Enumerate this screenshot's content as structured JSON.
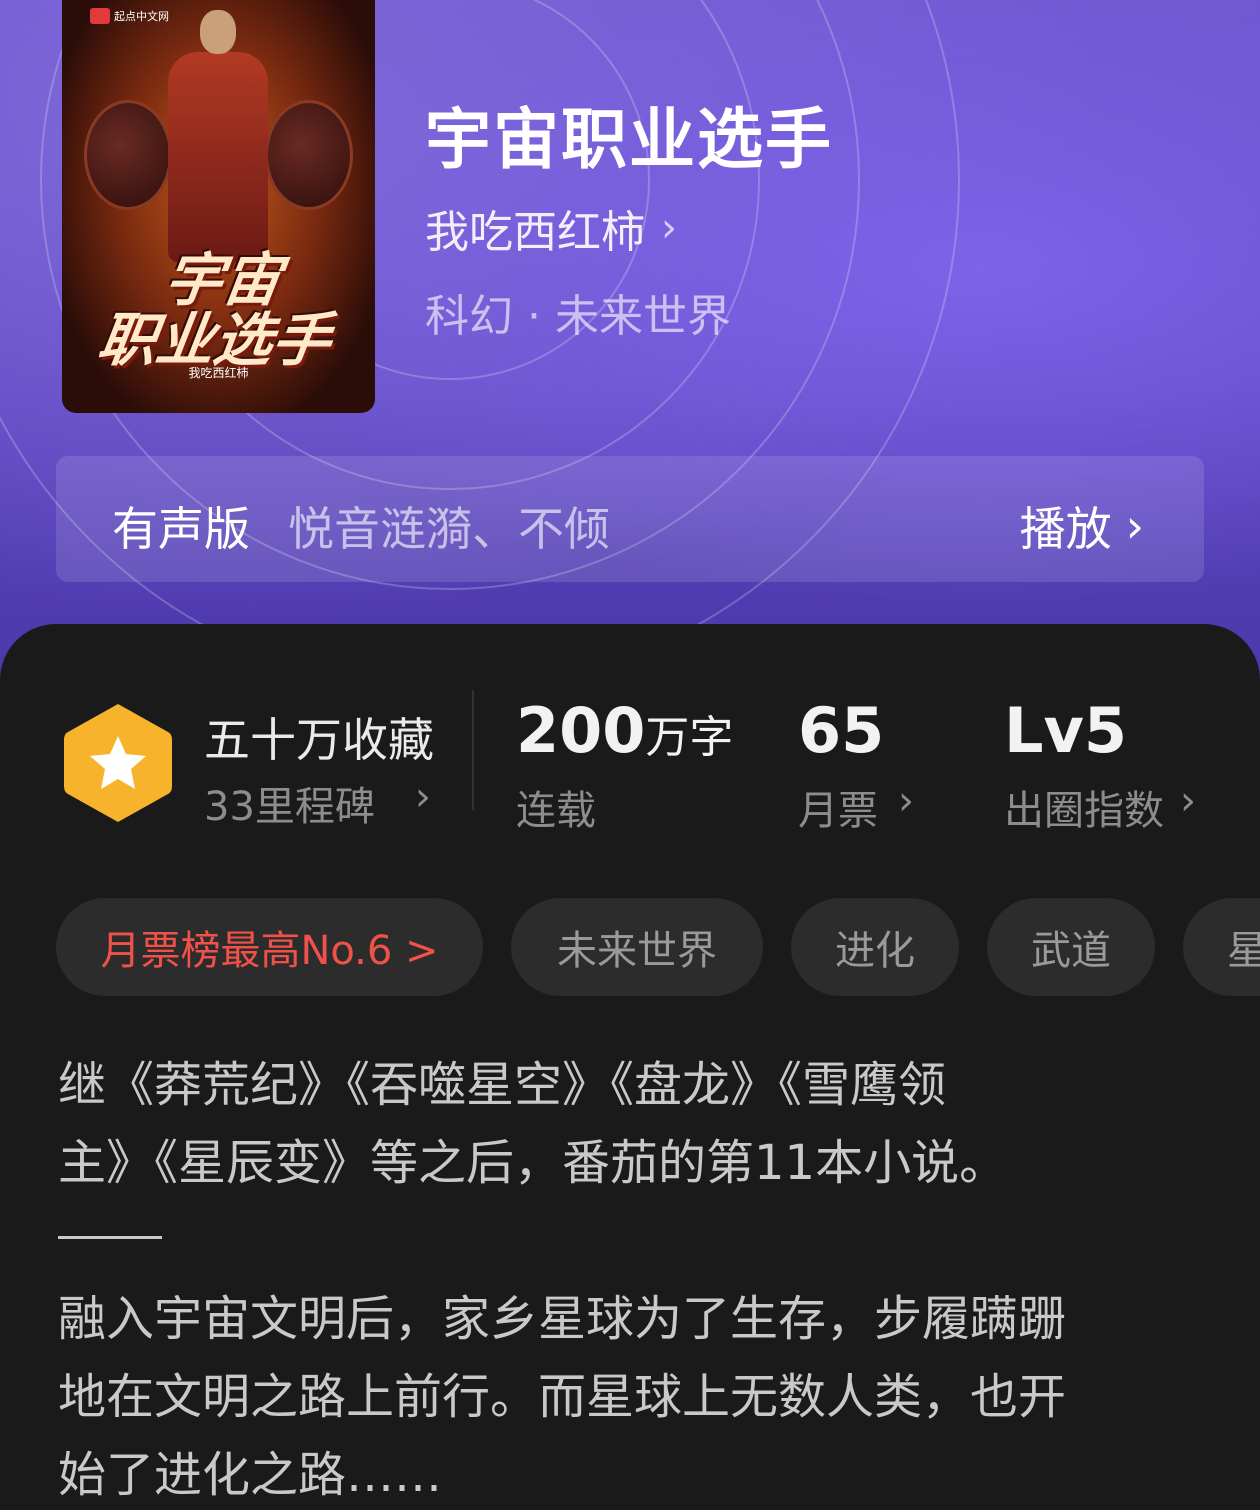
{
  "book": {
    "title": "宇宙职业选手",
    "author": "我吃西红柿",
    "genre": "科幻 · 未来世界",
    "cover": {
      "publisher": "起点中文网",
      "title_line1": "宇宙",
      "title_line2": "职业选手",
      "author": "我吃西红柿"
    }
  },
  "audio": {
    "label": "有声版",
    "narrators": "悦音涟漪、不倾",
    "play": "播放"
  },
  "stats": {
    "collections": "五十万收藏",
    "milestones": "33里程碑",
    "words_number": "200",
    "words_unit": "万字",
    "status": "连载",
    "monthly_votes": "65",
    "monthly_votes_label": "月票",
    "level": "Lv5",
    "level_label": "出圈指数"
  },
  "tags": [
    "月票榜最高No.6 >",
    "未来世界",
    "进化",
    "武道",
    "星"
  ],
  "description": {
    "lines_part1": [
      "继《莽荒纪》《吞噬星空》《盘龙》《雪鹰领",
      "主》《星辰变》等之后，番茄的第11本小说。"
    ],
    "lines_part2": [
      "融入宇宙文明后，家乡星球为了生存，步履蹒跚",
      "地在文明之路上前行。而星球上无数人类，也开",
      "始了进化之路……"
    ]
  },
  "colors": {
    "hero_purple": "#6d58cf",
    "sheet_bg": "#1a1a1b",
    "rank_red": "#f0524a",
    "badge_yellow": "#f7b32b"
  },
  "icons": {
    "milestone": "star-hexagon-icon",
    "chevron": "chevron-right-icon"
  }
}
